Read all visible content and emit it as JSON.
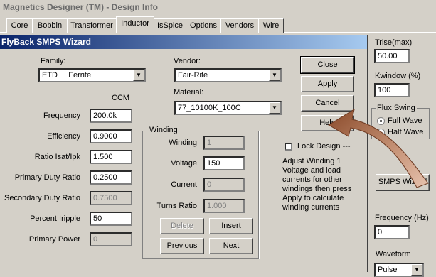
{
  "main_window": {
    "title": "Magnetics Designer (TM) - Design Info",
    "tabs": [
      "Core",
      "Bobbin",
      "Transformer",
      "Inductor",
      "IsSpice",
      "Options",
      "Vendors",
      "Wire"
    ],
    "active_tab": "Inductor"
  },
  "right_panel": {
    "trise_label": "Trise(max)",
    "trise_value": "50.00",
    "kwindow_label": "Kwindow (%)",
    "kwindow_value": "100",
    "flux_swing_label": "Flux Swing",
    "full_wave_label": "Full Wave",
    "half_wave_label": "Half Wave",
    "smps_wizard_label": "SMPS Wizard",
    "frequency_label": "Frequency (Hz)",
    "frequency_value": "0",
    "waveform_label": "Waveform",
    "waveform_value": "Pulse"
  },
  "dialog": {
    "title": "FlyBack SMPS Wizard",
    "family_label": "Family:",
    "family_value": "ETD     Ferrite",
    "vendor_label": "Vendor:",
    "vendor_value": "Fair-Rite",
    "material_label": "Material:",
    "material_value": "77_10100K_100C",
    "ccm_label": "CCM",
    "params": [
      {
        "label": "Frequency",
        "value": "200.0k",
        "disabled": false
      },
      {
        "label": "Efficiency",
        "value": "0.9000",
        "disabled": false
      },
      {
        "label": "Ratio Isat/Ipk",
        "value": "1.500",
        "disabled": false
      },
      {
        "label": "Primary Duty Ratio",
        "value": "0.2500",
        "disabled": false
      },
      {
        "label": "Secondary Duty Ratio",
        "value": "0.7500",
        "disabled": true
      },
      {
        "label": "Percent Iripple",
        "value": "50",
        "disabled": false
      },
      {
        "label": "Primary Power",
        "value": "0",
        "disabled": true
      }
    ],
    "winding": {
      "group_label": "Winding",
      "winding_label": "Winding",
      "winding_value": "1",
      "voltage_label": "Voltage",
      "voltage_value": "150",
      "current_label": "Current",
      "current_value": "0",
      "turns_ratio_label": "Turns Ratio",
      "turns_ratio_value": "1.000",
      "delete_label": "Delete",
      "insert_label": "Insert",
      "previous_label": "Previous",
      "next_label": "Next"
    },
    "buttons": {
      "close": "Close",
      "apply": "Apply",
      "cancel": "Cancel",
      "help": "Help"
    },
    "lock_design_label": "Lock Design ---",
    "help_text": "Adjust Winding 1 Voltage and load currents for other windings then press Apply to calculate winding currents"
  },
  "colors": {
    "dialog_title_start": "#0a246a",
    "dialog_title_end": "#a6caf0",
    "annotation_arrow": "#b0785a"
  }
}
